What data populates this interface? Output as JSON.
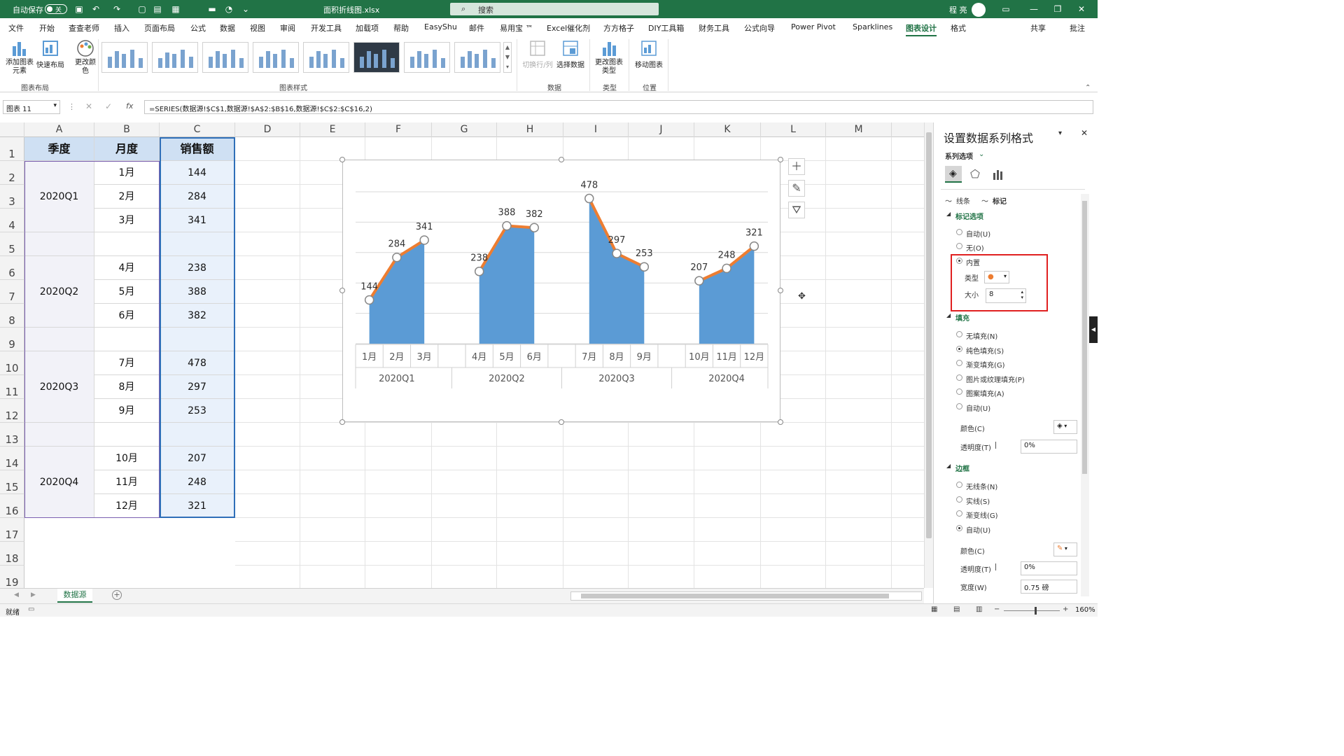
{
  "titlebar": {
    "autosave_label": "自动保存",
    "autosave_state": "关",
    "filename": "面积折线图.xlsx",
    "search_placeholder": "搜索",
    "user_name": "程 亮"
  },
  "ribbon_tabs": [
    "文件",
    "开始",
    "查查老师",
    "插入",
    "页面布局",
    "公式",
    "数据",
    "视图",
    "审阅",
    "开发工具",
    "加载项",
    "帮助",
    "EasyShu",
    "邮件",
    "易用宝 ™",
    "Excel催化剂",
    "方方格子",
    "DIY工具箱",
    "财务工具",
    "公式向导",
    "Power Pivot",
    "Sparklines",
    "图表设计",
    "格式"
  ],
  "ribbon_right": {
    "share": "共享",
    "comment": "批注"
  },
  "ribbon": {
    "add_element": "添加图表元素",
    "quick_layout": "快速布局",
    "change_colors": "更改颜色",
    "group_layout": "图表布局",
    "group_styles": "图表样式",
    "switch_row_col": "切换行/列",
    "select_data": "选择数据",
    "group_data": "数据",
    "change_type": "更改图表类型",
    "group_type": "类型",
    "move_chart": "移动图表",
    "group_location": "位置"
  },
  "formula_bar": {
    "name_box": "图表 11",
    "fx": "fx",
    "formula": "=SERIES(数据源!$C$1,数据源!$A$2:$B$16,数据源!$C$2:$C$16,2)"
  },
  "columns": [
    "A",
    "B",
    "C",
    "D",
    "E",
    "F",
    "G",
    "H",
    "I",
    "J",
    "K",
    "L",
    "M"
  ],
  "rows": [
    "1",
    "2",
    "3",
    "4",
    "5",
    "6",
    "7",
    "8",
    "9",
    "10",
    "11",
    "12",
    "13",
    "14",
    "15",
    "16",
    "17",
    "18",
    "19"
  ],
  "table": {
    "headers": [
      "季度",
      "月度",
      "销售额"
    ],
    "quarters": [
      "2020Q1",
      "2020Q2",
      "2020Q3",
      "2020Q4"
    ],
    "months": [
      "1月",
      "2月",
      "3月",
      "4月",
      "5月",
      "6月",
      "7月",
      "8月",
      "9月",
      "10月",
      "11月",
      "12月"
    ],
    "sales": [
      "144",
      "284",
      "341",
      "238",
      "388",
      "382",
      "478",
      "297",
      "253",
      "207",
      "248",
      "321"
    ]
  },
  "chart_data": {
    "type": "area",
    "categories": [
      "1月",
      "2月",
      "3月",
      "4月",
      "5月",
      "6月",
      "7月",
      "8月",
      "9月",
      "10月",
      "11月",
      "12月"
    ],
    "groups": [
      "2020Q1",
      "2020Q2",
      "2020Q3",
      "2020Q4"
    ],
    "series": [
      {
        "values": [
          144,
          284,
          341,
          238,
          388,
          382,
          478,
          297,
          253,
          207,
          248,
          321
        ]
      }
    ],
    "ylim": [
      0,
      500
    ],
    "grid": true,
    "area_color": "#5b9bd5",
    "line_color": "#ed7d31"
  },
  "sheet_tab": "数据源",
  "status": {
    "ready": "就绪",
    "zoom": "160%"
  },
  "pane": {
    "title": "设置数据系列格式",
    "series_options": "系列选项",
    "tab_line": "线条",
    "tab_marker": "标记",
    "marker_options": "标记选项",
    "auto": "自动(U)",
    "none": "无(O)",
    "builtin": "内置",
    "type_label": "类型",
    "size_label": "大小",
    "size_value": "8",
    "fill": "填充",
    "fill_options": [
      "无填充(N)",
      "纯色填充(S)",
      "渐变填充(G)",
      "图片或纹理填充(P)",
      "图案填充(A)",
      "自动(U)"
    ],
    "color_label": "颜色(C)",
    "transparency_label": "透明度(T)",
    "transparency_value": "0%",
    "border": "边框",
    "border_options": [
      "无线条(N)",
      "实线(S)",
      "渐变线(G)",
      "自动(U)"
    ],
    "width_label": "宽度(W)",
    "width_value": "0.75 磅",
    "highlight_color": "#e02020"
  }
}
